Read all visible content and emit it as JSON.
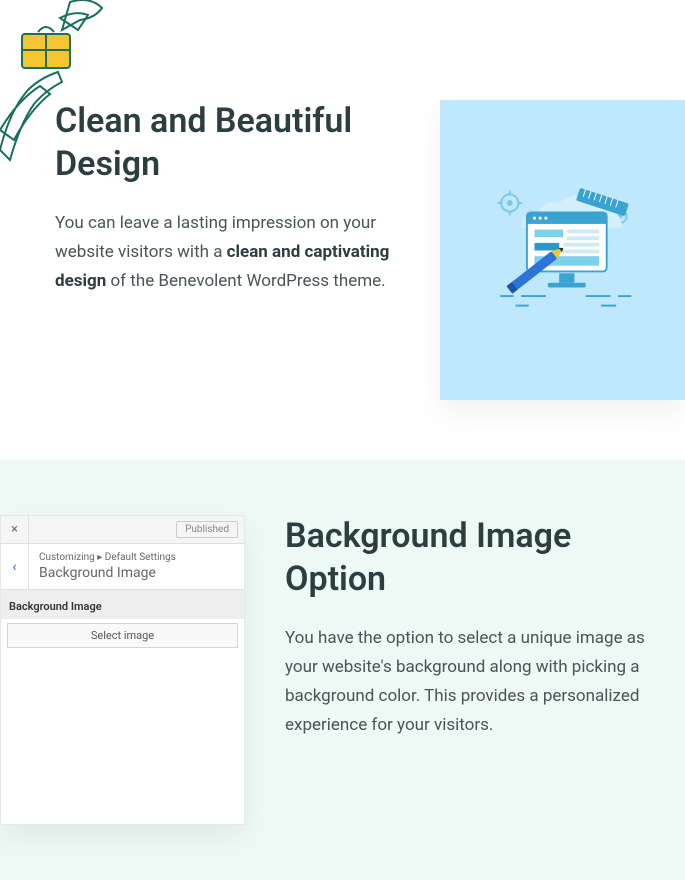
{
  "section1": {
    "heading": "Clean and Beautiful Design",
    "text_before": "You can leave a lasting impression on your website visitors with a ",
    "text_bold": "clean and captivating design",
    "text_after": " of the Benevolent WordPress theme."
  },
  "section2": {
    "heading": "Background Image Option",
    "body": "You have the option to select a unique image as your website's background along with picking a background color. This provides a personalized experience for your visitors."
  },
  "customizer": {
    "close_char": "×",
    "publish_label": "Published",
    "back_char": "‹",
    "breadcrumb_small": "Customizing ▸ Default Settings",
    "breadcrumb_large": "Background Image",
    "field_label": "Background Image",
    "select_label": "Select image"
  }
}
